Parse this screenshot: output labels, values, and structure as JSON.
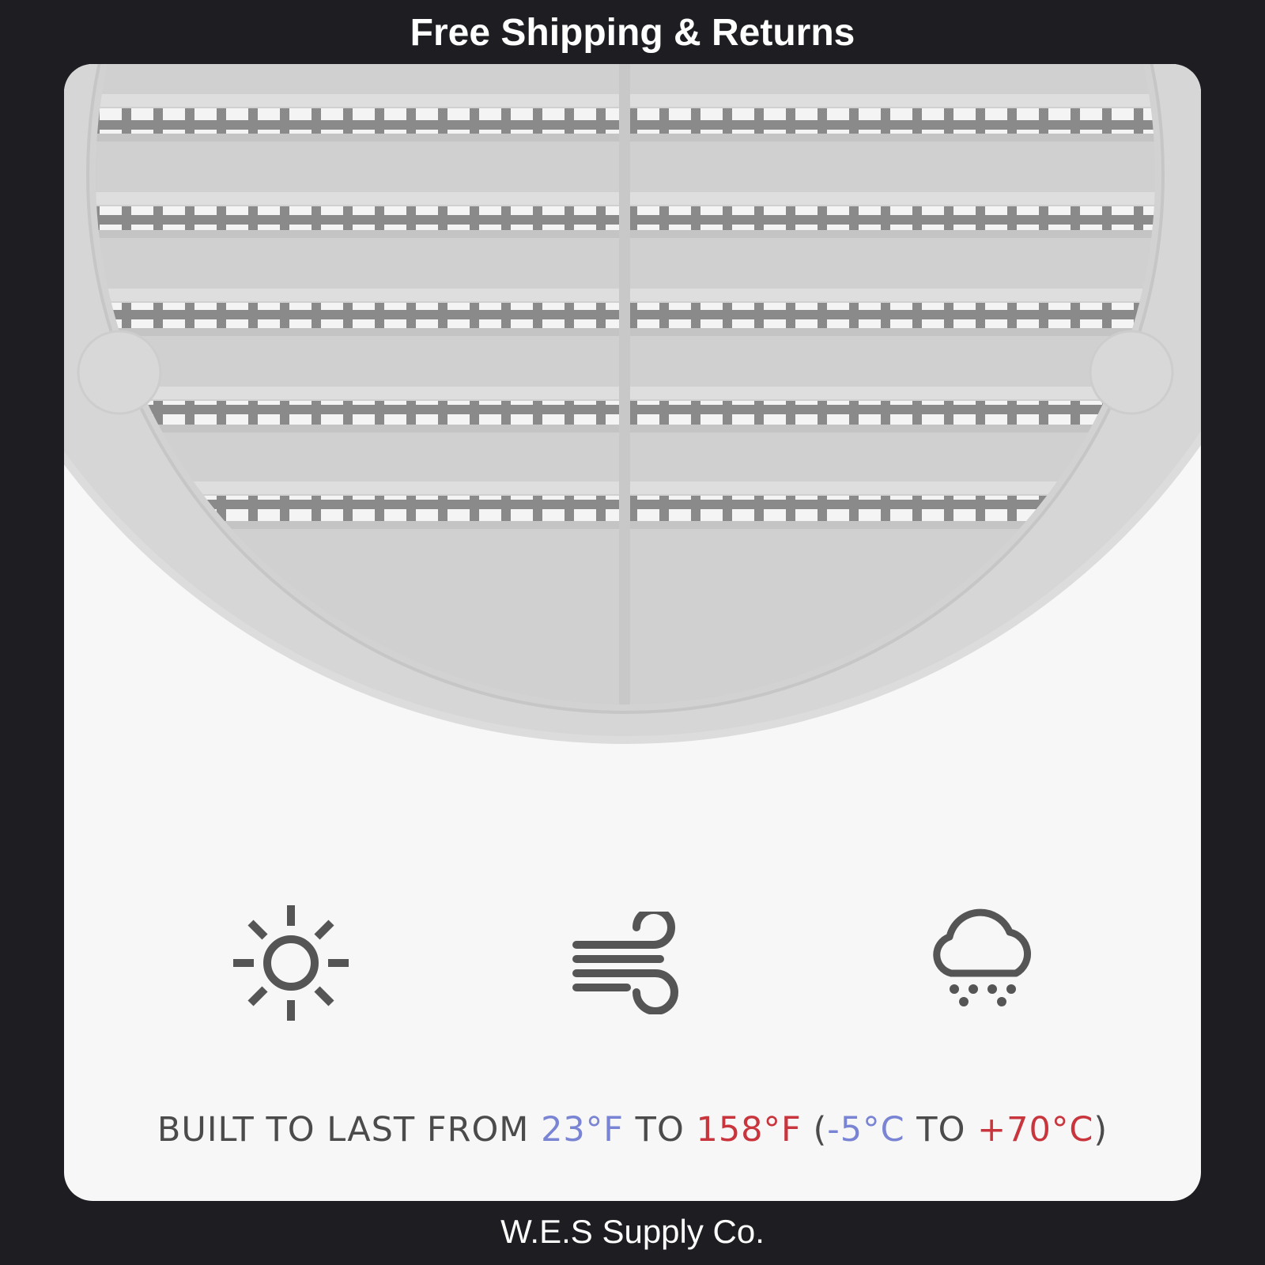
{
  "banner": {
    "text": "Free Shipping & Returns"
  },
  "product_image": {
    "subject": "round plastic vent grille",
    "icons": [
      "sun-icon",
      "wind-icon",
      "snow-cloud-icon"
    ]
  },
  "claim": {
    "part1": "BUILT TO LAST FROM ",
    "temp_low_f": "23°F",
    "to_1": " TO ",
    "temp_high_f": "158°F",
    "paren_open": " (",
    "temp_low_c": "-5°C",
    "to_2": " TO ",
    "temp_high_c": "+70°C",
    "paren_close": ")"
  },
  "colors": {
    "background": "#1e1d22",
    "card": "#f7f7f7",
    "cold": "#7a84d4",
    "hot": "#c8353c",
    "icon": "#555555"
  },
  "footer": {
    "brand": "W.E.S Supply Co."
  }
}
